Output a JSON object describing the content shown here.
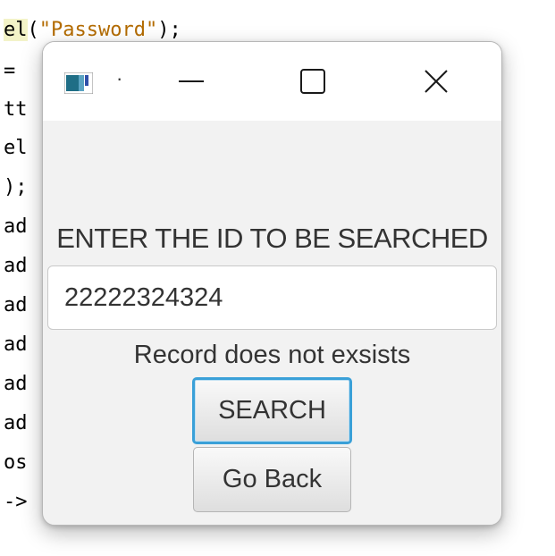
{
  "background_code": {
    "lines": [
      {
        "prefix": "el",
        "string": "\"Password\"",
        "suffix": ");"
      },
      {
        "text": "="
      },
      {
        "text": "tt"
      },
      {
        "text": "el"
      },
      {
        "text": ");"
      },
      {
        "text": "ad"
      },
      {
        "text": "ad"
      },
      {
        "text": "ad"
      },
      {
        "text": "ad"
      },
      {
        "text": "ad"
      },
      {
        "text": "ad"
      },
      {
        "text": "os"
      },
      {
        "text": "->"
      }
    ],
    "open_paren": "("
  },
  "window": {
    "title": "·",
    "controls": {
      "minimize": "—",
      "maximize": "☐",
      "close": "✕"
    }
  },
  "form": {
    "prompt": "ENTER THE ID TO BE SEARCHED",
    "id_value": "22222324324",
    "status": "Record does not exsists",
    "search_label": "SEARCH",
    "back_label": "Go Back"
  },
  "colors": {
    "accent_focus": "#3aa0d8",
    "text": "#333333",
    "window_bg": "#f2f2f2"
  }
}
